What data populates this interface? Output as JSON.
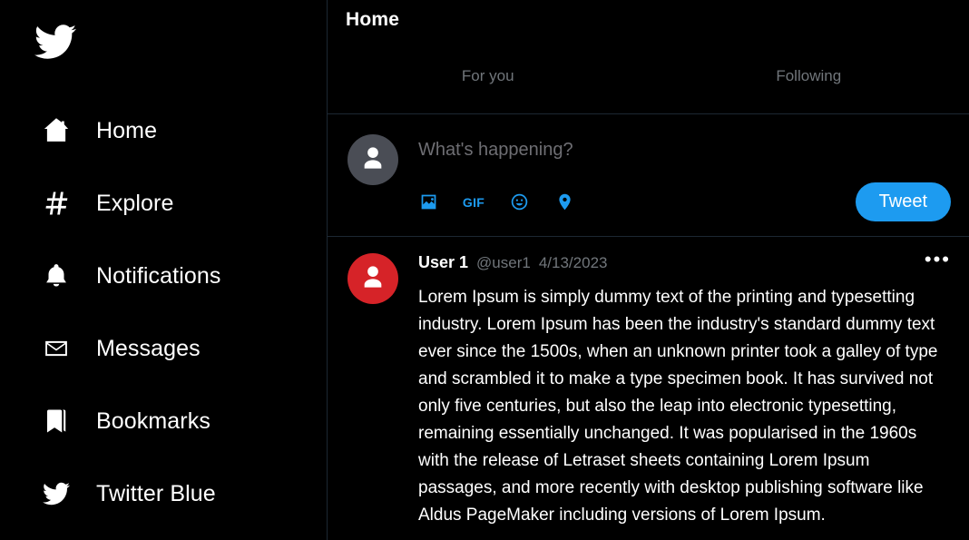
{
  "sidebar": {
    "logo_icon": "twitter-bird-icon",
    "items": [
      {
        "label": "Home",
        "icon": "home-icon"
      },
      {
        "label": "Explore",
        "icon": "hashtag-icon"
      },
      {
        "label": "Notifications",
        "icon": "bell-icon"
      },
      {
        "label": "Messages",
        "icon": "envelope-icon"
      },
      {
        "label": "Bookmarks",
        "icon": "bookmark-icon"
      },
      {
        "label": "Twitter Blue",
        "icon": "twitter-bird-icon"
      }
    ]
  },
  "main": {
    "title": "Home",
    "tabs": [
      {
        "label": "For you",
        "active": false
      },
      {
        "label": "Following",
        "active": false
      }
    ],
    "compose": {
      "placeholder": "What's happening?",
      "avatar_color": "#4a4d55",
      "icons": [
        {
          "name": "image-icon",
          "label": ""
        },
        {
          "name": "gif-icon",
          "label": "GIF"
        },
        {
          "name": "emoji-icon",
          "label": ""
        },
        {
          "name": "location-icon",
          "label": ""
        }
      ],
      "tweet_button": "Tweet"
    },
    "tweet": {
      "avatar_color": "#d62328",
      "display_name": "User 1",
      "handle": "@user1",
      "date": "4/13/2023",
      "more_label": "•••",
      "body": "Lorem Ipsum is simply dummy text of the printing and typesetting industry. Lorem Ipsum has been the industry's standard dummy text ever since the 1500s, when an unknown printer took a galley of type and scrambled it to make a type specimen book. It has survived not only five centuries, but also the leap into electronic typesetting, remaining essentially unchanged. It was popularised in the 1960s with the release of Letraset sheets containing Lorem Ipsum passages, and more recently with desktop publishing software like Aldus PageMaker including versions of Lorem Ipsum."
    }
  },
  "colors": {
    "background": "#000000",
    "accent_blue": "#1d9bf0",
    "muted_text": "#71767b",
    "border": "#1c2732"
  }
}
